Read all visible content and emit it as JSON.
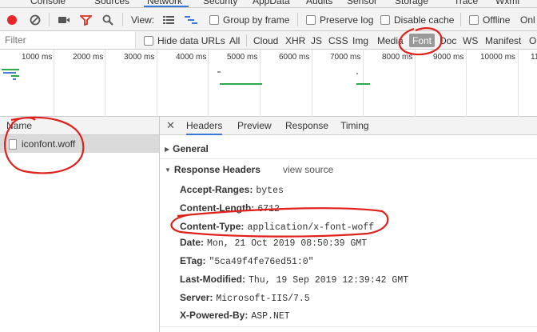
{
  "devtools_tabs": [
    {
      "label": "Console",
      "active": false
    },
    {
      "label": "Sources",
      "active": false
    },
    {
      "label": "Network",
      "active": true
    },
    {
      "label": "Security",
      "active": false
    },
    {
      "label": "AppData",
      "active": false
    },
    {
      "label": "Audits",
      "active": false
    },
    {
      "label": "Sensor",
      "active": false
    },
    {
      "label": "Storage",
      "active": false
    },
    {
      "label": "Trace",
      "active": false
    },
    {
      "label": "Wxml",
      "active": false
    }
  ],
  "toolbar": {
    "view_label": "View:",
    "group_by_frame": "Group by frame",
    "preserve_log": "Preserve log",
    "disable_cache": "Disable cache",
    "offline": "Offline",
    "online": "Onl",
    "record_color": "#e8262a",
    "filter_icon_color": "#d93025"
  },
  "filterbar": {
    "placeholder": "Filter",
    "hide_data_urls": "Hide data URLs",
    "types": [
      "All",
      "Cloud",
      "XHR",
      "JS",
      "CSS",
      "Img",
      "Media",
      "Font",
      "Doc",
      "WS",
      "Manifest",
      "O"
    ],
    "selected_type": "Font"
  },
  "timeline": {
    "ticks": [
      "1000 ms",
      "2000 ms",
      "3000 ms",
      "4000 ms",
      "5000 ms",
      "6000 ms",
      "7000 ms",
      "8000 ms",
      "9000 ms",
      "10000 ms",
      "11"
    ],
    "bar_color_green": "#2aa84a",
    "bar_color_blue": "#4a7fd6"
  },
  "request_list": {
    "header": "Name",
    "rows": [
      {
        "name": "iconfont.woff"
      }
    ]
  },
  "detail": {
    "tabs": [
      "Headers",
      "Preview",
      "Response",
      "Timing"
    ],
    "active_tab": "Headers",
    "general_label": "General",
    "response_headers_label": "Response Headers",
    "view_source": "view source",
    "headers": [
      {
        "name": "Accept-Ranges:",
        "value": "bytes"
      },
      {
        "name": "Content-Length:",
        "value": "6712"
      },
      {
        "name": "Content-Type:",
        "value": "application/x-font-woff"
      },
      {
        "name": "Date:",
        "value": "Mon, 21 Oct 2019 08:50:39 GMT"
      },
      {
        "name": "ETag:",
        "value": "\"5ca49f4fe76ed51:0\""
      },
      {
        "name": "Last-Modified:",
        "value": "Thu, 19 Sep 2019 12:39:42 GMT"
      },
      {
        "name": "Server:",
        "value": "Microsoft-IIS/7.5"
      },
      {
        "name": "X-Powered-By:",
        "value": "ASP.NET"
      }
    ]
  },
  "annotation_color": "#e0201b"
}
